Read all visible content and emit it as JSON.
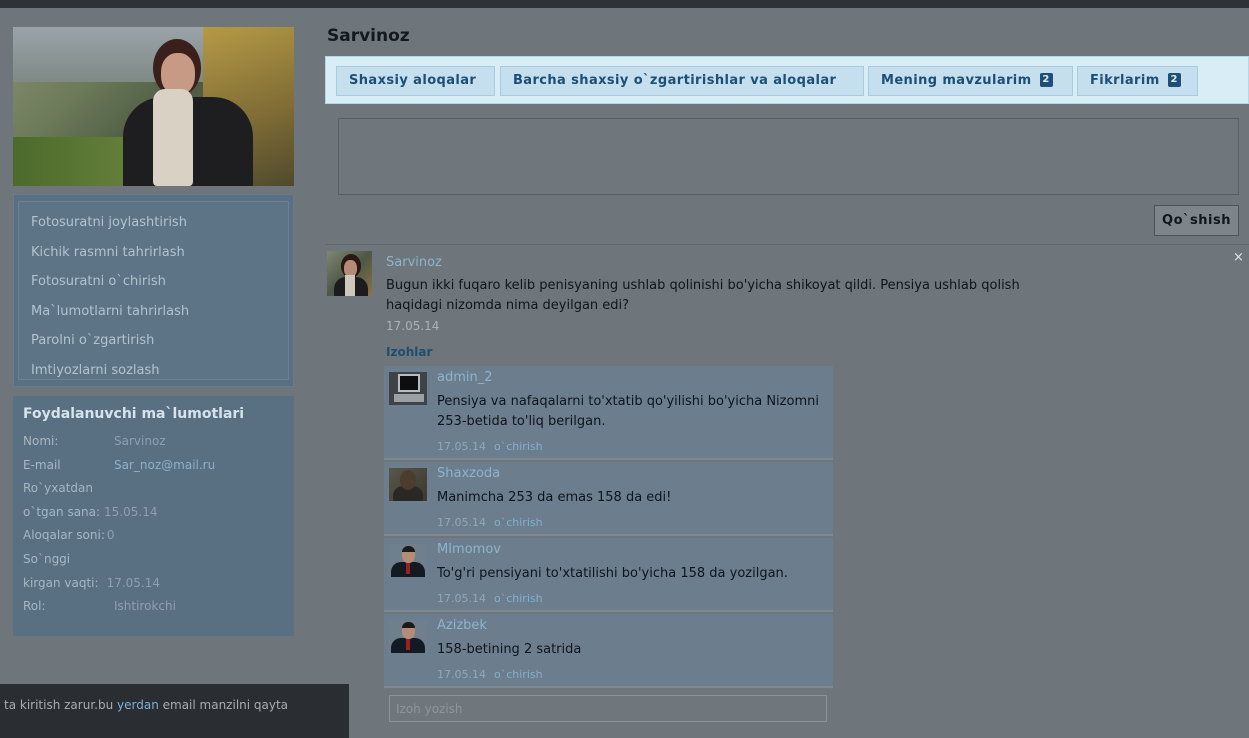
{
  "user": {
    "name": "Sarvinoz"
  },
  "tabs": [
    {
      "label": "Shaxsiy aloqalar",
      "badge": ""
    },
    {
      "label": "Barcha shaxsiy o`zgartirishlar va aloqalar",
      "badge": ""
    },
    {
      "label": "Mening mavzularim",
      "badge": "2"
    },
    {
      "label": "Fikrlarim",
      "badge": "2"
    }
  ],
  "sidebar": {
    "menu": [
      "Fotosuratni joylashtirish",
      "Kichik rasmni tahrirlash",
      "Fotosuratni o`chirish",
      "Ma`lumotlarni tahrirlash",
      "Parolni o`zgartirish",
      "Imtiyozlarni sozlash"
    ],
    "info": {
      "title": "Foydalanuvchi ma`lumotlari",
      "nomi_label": "Nomi:",
      "nomi_value": "Sarvinoz",
      "email_label": "E-mail",
      "email_value": "Sar_noz@mail.ru",
      "reg_label_1": "Ro`yxatdan",
      "reg_label_2": "o`tgan sana:",
      "reg_value": "15.05.14",
      "count_label": "Aloqalar soni:",
      "count_value": "0",
      "last_label_1": "So`nggi",
      "last_label_2": "kirgan vaqti:",
      "last_value": "17.05.14",
      "role_label": "Rol:",
      "role_value": "Ishtirokchi"
    }
  },
  "composer": {
    "submit_label": "Qo`shish",
    "close_glyph": "×"
  },
  "post": {
    "author": "Sarvinoz",
    "text": "Bugun ikki fuqaro kelib penisyaning ushlab qolinishi bo'yicha shikoyat qildi. Pensiya ushlab qolish haqidagi nizomda nima deyilgan edi?",
    "date": "17.05.14",
    "comments_heading": "Izohlar"
  },
  "comments": [
    {
      "author": "admin_2",
      "text": "Pensiya va nafaqalarni to'xtatib qo'yilishi bo'yicha Nizomni 253-betida to'liq berilgan.",
      "date": "17.05.14",
      "delete_label": "o`chirish"
    },
    {
      "author": "Shaxzoda",
      "text": "Manimcha 253 da emas 158 da edi!",
      "date": "17.05.14",
      "delete_label": "o`chirish"
    },
    {
      "author": "MImomov",
      "text": "To'g'ri pensiyani to'xtatilishi bo'yicha 158 da yozilgan.",
      "date": "17.05.14",
      "delete_label": "o`chirish"
    },
    {
      "author": "Azizbek",
      "text": "158-betining 2 satrida",
      "date": "17.05.14",
      "delete_label": "o`chirish"
    }
  ],
  "comment_input": {
    "placeholder": "Izoh yozish"
  },
  "notice": {
    "prefix": "ta kiritish zarur.bu ",
    "link": "yerdan",
    "suffix": " email manzilni qayta"
  }
}
